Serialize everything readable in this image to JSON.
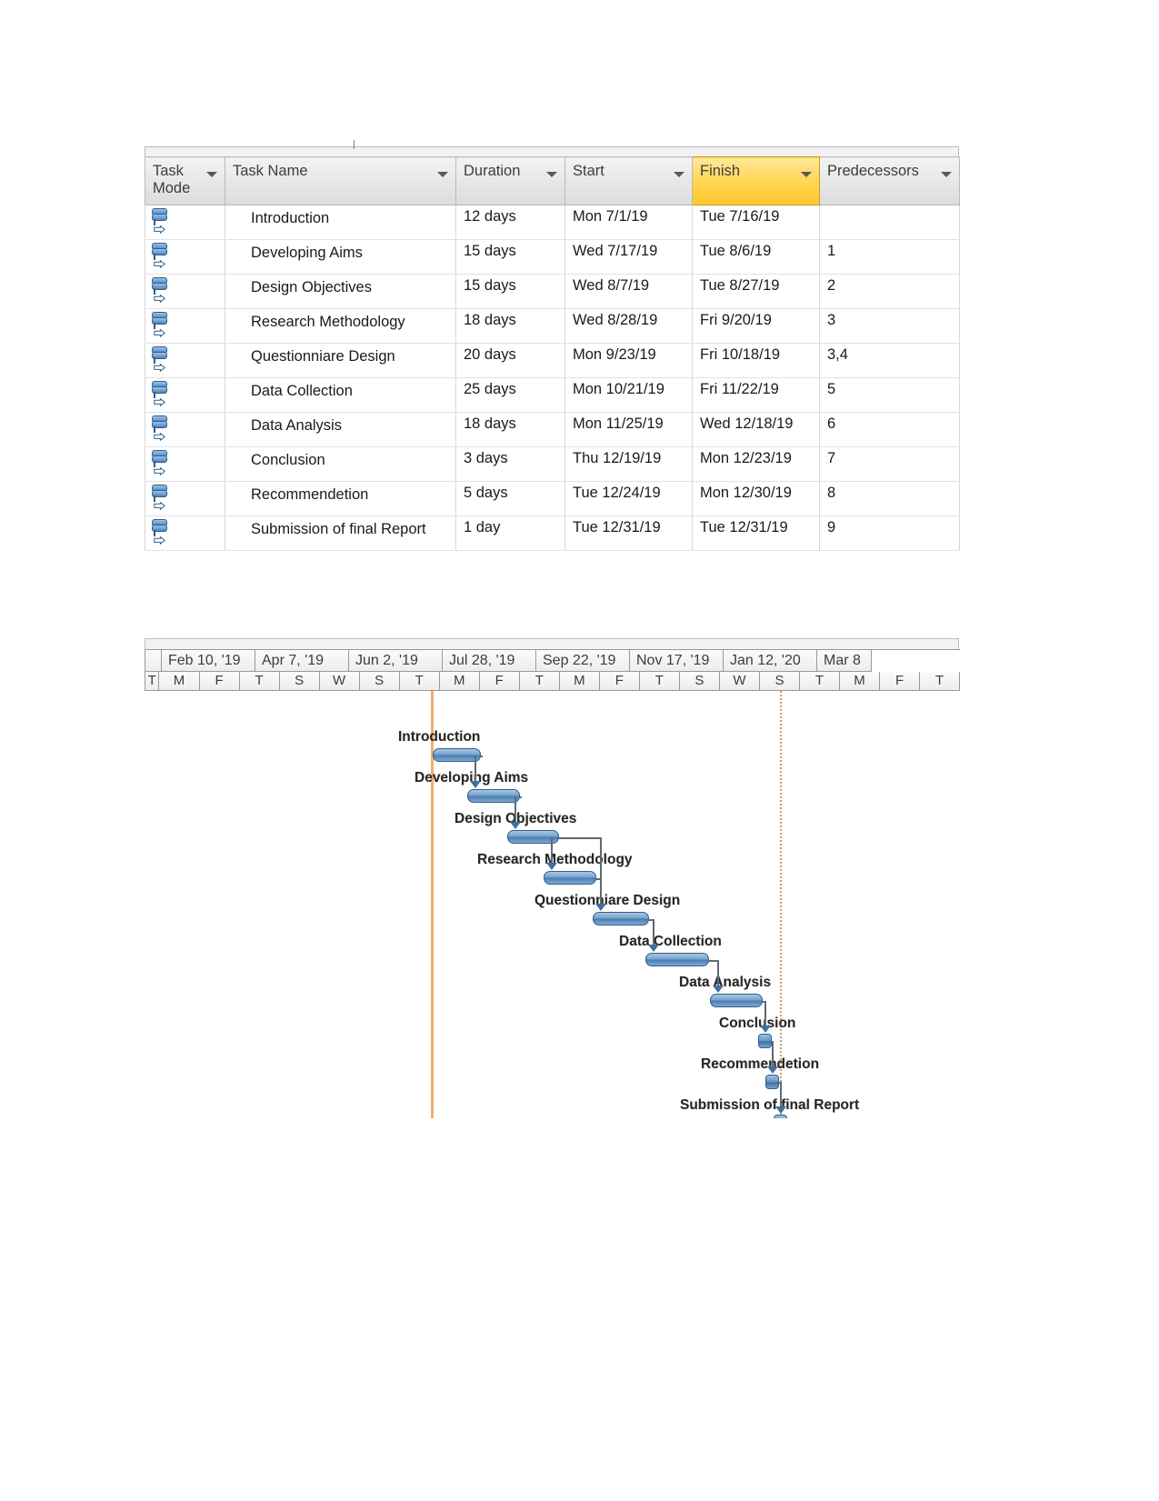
{
  "table": {
    "columns": [
      {
        "key": "mode",
        "label": "Task Mode",
        "highlight": false
      },
      {
        "key": "name",
        "label": "Task Name",
        "highlight": false
      },
      {
        "key": "dur",
        "label": "Duration",
        "highlight": false
      },
      {
        "key": "start",
        "label": "Start",
        "highlight": false
      },
      {
        "key": "finish",
        "label": "Finish",
        "highlight": true
      },
      {
        "key": "pred",
        "label": "Predecessors",
        "highlight": false
      }
    ],
    "rows": [
      {
        "mode": "auto-schedule-icon",
        "name": "Introduction",
        "dur": "12 days",
        "start": "Mon 7/1/19",
        "finish": "Tue 7/16/19",
        "pred": ""
      },
      {
        "mode": "auto-schedule-icon",
        "name": "Developing Aims",
        "dur": "15 days",
        "start": "Wed 7/17/19",
        "finish": "Tue 8/6/19",
        "pred": "1"
      },
      {
        "mode": "auto-schedule-icon",
        "name": "Design Objectives",
        "dur": "15 days",
        "start": "Wed 8/7/19",
        "finish": "Tue 8/27/19",
        "pred": "2"
      },
      {
        "mode": "auto-schedule-icon",
        "name": "Research Methodology",
        "dur": "18 days",
        "start": "Wed 8/28/19",
        "finish": "Fri 9/20/19",
        "pred": "3"
      },
      {
        "mode": "auto-schedule-icon",
        "name": "Questionniare Design",
        "dur": "20 days",
        "start": "Mon 9/23/19",
        "finish": "Fri 10/18/19",
        "pred": "3,4"
      },
      {
        "mode": "auto-schedule-icon",
        "name": "Data Collection",
        "dur": "25 days",
        "start": "Mon 10/21/19",
        "finish": "Fri 11/22/19",
        "pred": "5"
      },
      {
        "mode": "auto-schedule-icon",
        "name": "Data Analysis",
        "dur": "18 days",
        "start": "Mon 11/25/19",
        "finish": "Wed 12/18/19",
        "pred": "6"
      },
      {
        "mode": "auto-schedule-icon",
        "name": "Conclusion",
        "dur": "3 days",
        "start": "Thu 12/19/19",
        "finish": "Mon 12/23/19",
        "pred": "7"
      },
      {
        "mode": "auto-schedule-icon",
        "name": "Recommendetion",
        "dur": "5 days",
        "start": "Tue 12/24/19",
        "finish": "Mon 12/30/19",
        "pred": "8"
      },
      {
        "mode": "auto-schedule-icon",
        "name": "Submission of final Report",
        "dur": "1 day",
        "start": "Tue 12/31/19",
        "finish": "Tue 12/31/19",
        "pred": "9"
      }
    ]
  },
  "chart_data": {
    "type": "bar",
    "title": "Project Schedule Gantt Chart",
    "xlabel": "",
    "ylabel": "",
    "timeline": {
      "major_ticks": [
        "Feb 10, '19",
        "Apr 7, '19",
        "Jun 2, '19",
        "Jul 28, '19",
        "Sep 22, '19",
        "Nov 17, '19",
        "Jan 12, '20",
        "Mar 8"
      ],
      "minor_ticks": [
        "T",
        "M",
        "F",
        "T",
        "S",
        "W",
        "S",
        "T",
        "M",
        "F",
        "T",
        "M",
        "F",
        "T",
        "S",
        "W",
        "S",
        "T",
        "M",
        "F",
        "T"
      ],
      "today_line_color": "#f4ad6e",
      "status_line_color": "#c8a06a"
    },
    "bars": [
      {
        "label": "Introduction",
        "start": "Mon 7/1/19",
        "finish": "Tue 7/16/19",
        "duration_days": 12,
        "kind": "task"
      },
      {
        "label": "Developing Aims",
        "start": "Wed 7/17/19",
        "finish": "Tue 8/6/19",
        "duration_days": 15,
        "kind": "task"
      },
      {
        "label": "Design Objectives",
        "start": "Wed 8/7/19",
        "finish": "Tue 8/27/19",
        "duration_days": 15,
        "kind": "task"
      },
      {
        "label": "Research Methodology",
        "start": "Wed 8/28/19",
        "finish": "Fri 9/20/19",
        "duration_days": 18,
        "kind": "task"
      },
      {
        "label": "Questionniare Design",
        "start": "Mon 9/23/19",
        "finish": "Fri 10/18/19",
        "duration_days": 20,
        "kind": "task"
      },
      {
        "label": "Data Collection",
        "start": "Mon 10/21/19",
        "finish": "Fri 11/22/19",
        "duration_days": 25,
        "kind": "task"
      },
      {
        "label": "Data Analysis",
        "start": "Mon 11/25/19",
        "finish": "Wed 12/18/19",
        "duration_days": 18,
        "kind": "task"
      },
      {
        "label": "Conclusion",
        "start": "Thu 12/19/19",
        "finish": "Mon 12/23/19",
        "duration_days": 3,
        "kind": "short"
      },
      {
        "label": "Recommendetion",
        "start": "Tue 12/24/19",
        "finish": "Mon 12/30/19",
        "duration_days": 5,
        "kind": "short"
      },
      {
        "label": "Submission of final Report",
        "start": "Tue 12/31/19",
        "finish": "Tue 12/31/19",
        "duration_days": 1,
        "kind": "short"
      }
    ],
    "links": [
      {
        "from": "Introduction",
        "to": "Developing Aims"
      },
      {
        "from": "Developing Aims",
        "to": "Design Objectives"
      },
      {
        "from": "Design Objectives",
        "to": "Research Methodology"
      },
      {
        "from": "Design Objectives",
        "to": "Questionniare Design"
      },
      {
        "from": "Research Methodology",
        "to": "Questionniare Design"
      },
      {
        "from": "Questionniare Design",
        "to": "Data Collection"
      },
      {
        "from": "Data Collection",
        "to": "Data Analysis"
      },
      {
        "from": "Data Analysis",
        "to": "Conclusion"
      },
      {
        "from": "Conclusion",
        "to": "Recommendetion"
      },
      {
        "from": "Recommendetion",
        "to": "Submission of final Report"
      }
    ],
    "colors": {
      "bar_fill": "#4a7fb5",
      "bar_border": "#2f5f8f",
      "link": "#5f6a72",
      "header_highlight": "#ffc82e"
    }
  }
}
